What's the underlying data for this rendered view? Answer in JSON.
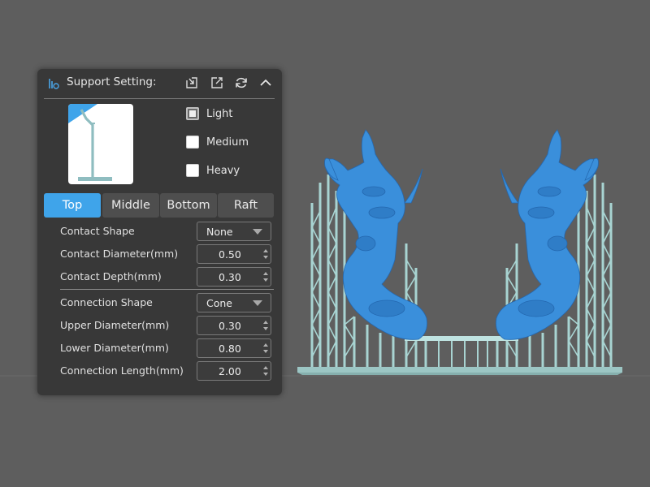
{
  "panel": {
    "title": "Support Setting:",
    "header_icons": [
      "support-logo-icon",
      "import-icon",
      "export-icon",
      "reset-icon",
      "collapse-icon"
    ]
  },
  "weights": [
    {
      "label": "Light",
      "checked": true
    },
    {
      "label": "Medium",
      "checked": false
    },
    {
      "label": "Heavy",
      "checked": false
    }
  ],
  "tabs": [
    {
      "label": "Top",
      "active": true
    },
    {
      "label": "Middle",
      "active": false
    },
    {
      "label": "Bottom",
      "active": false
    },
    {
      "label": "Raft",
      "active": false
    }
  ],
  "fields": {
    "contact_shape": {
      "label": "Contact Shape",
      "value": "None"
    },
    "contact_diameter": {
      "label": "Contact Diameter(mm)",
      "value": "0.50"
    },
    "contact_depth": {
      "label": "Contact Depth(mm)",
      "value": "0.30"
    },
    "connection_shape": {
      "label": "Connection Shape",
      "value": "Cone"
    },
    "upper_diameter": {
      "label": "Upper Diameter(mm)",
      "value": "0.30"
    },
    "lower_diameter": {
      "label": "Lower Diameter(mm)",
      "value": "0.80"
    },
    "connection_length": {
      "label": "Connection Length(mm)",
      "value": "2.00"
    }
  },
  "colors": {
    "accent": "#3fa4ea",
    "model": "#3a8fdb",
    "support": "#a8d4d2",
    "viewport": "#5e5e5e",
    "panel": "#383838"
  }
}
